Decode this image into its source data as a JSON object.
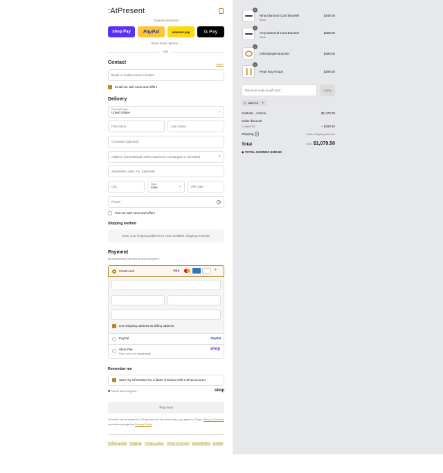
{
  "header": {
    "logo": ":AtPresent",
    "cart_icon": "bag-icon"
  },
  "express": {
    "label": "Express checkout",
    "shop_pay": "shop Pay",
    "paypal": "PayPal",
    "amazon": "amazon pay",
    "gpay": "G Pay",
    "more": "Show more options ⌄",
    "or": "OR"
  },
  "contact": {
    "title": "Contact",
    "login": "Log in",
    "email_placeholder": "Email or mobile phone number",
    "news": "Email me with news and offers"
  },
  "delivery": {
    "title": "Delivery",
    "country_label": "Country/Region",
    "country_value": "United States",
    "first": "First name",
    "last": "Last name",
    "company": "Company (optional)",
    "address": "Address (International orders cannot be exchanged or refunded)",
    "apt": "Apartment, suite, etc. (optional)",
    "city": "City",
    "state_label": "State",
    "state_value": "Iowa",
    "zip": "ZIP code",
    "phone": "Phone",
    "text_me": "Text me with news and offers"
  },
  "shipping_method": {
    "title": "Shipping method",
    "note": "Enter your shipping address to view available shipping methods."
  },
  "payment": {
    "title": "Payment",
    "subtitle": "All transactions are secure and encrypted.",
    "credit_card": "Credit card",
    "billing": "Use shipping address as billing address",
    "paypal": "PayPal",
    "paypal_logo": "PayPal",
    "shoppay": "Shop Pay",
    "shoppay_sub": "Pay in full or in installments",
    "shoppay_logo": "shop"
  },
  "remember": {
    "title": "Remember me",
    "save": "Save my information for a faster checkout with a Shop account",
    "secure": "Secure and encrypted",
    "shop_logo": "shop"
  },
  "paynow": "Pay now",
  "legal": {
    "line1": "Your info will be saved to a Shop account. By continuing, you agree to Shop's ",
    "terms": "Terms of Service",
    "line2": " and acknowledge the ",
    "privacy": "Privacy Policy",
    "end": "."
  },
  "footer": [
    "Refund policy",
    "Shipping",
    "Privacy policy",
    "Terms of service",
    "Cancellations",
    "Contact"
  ],
  "cart": {
    "items": [
      {
        "name": "Nina Diamond Cord Bracelet",
        "variant": "Black",
        "price": "$340.00",
        "qty": "1"
      },
      {
        "name": "Amy Diamond Cord Bracelet",
        "variant": "Black",
        "price": "$250.00",
        "qty": "1"
      },
      {
        "name": "Orbit Bangle Bracelet",
        "variant": "",
        "price": "$390.00",
        "qty": "1"
      },
      {
        "name": "Pearl Ray Hoops",
        "variant": "",
        "price": "$290.00",
        "qty": "1"
      }
    ],
    "discount_placeholder": "Discount code or gift card",
    "apply": "Apply",
    "code": "ABBY15",
    "subtotal_label": "Subtotal · 4 items",
    "subtotal": "$1,270.00",
    "order_discount": "Order discount",
    "discount_code": "ABBY15",
    "discount_value": "– $190.50",
    "shipping_label": "Shipping",
    "shipping_value": "Enter shipping address",
    "total_label": "Total",
    "currency": "USD",
    "total": "$1,079.50",
    "savings_label": "TOTAL SAVINGS",
    "savings": "$190.50"
  }
}
